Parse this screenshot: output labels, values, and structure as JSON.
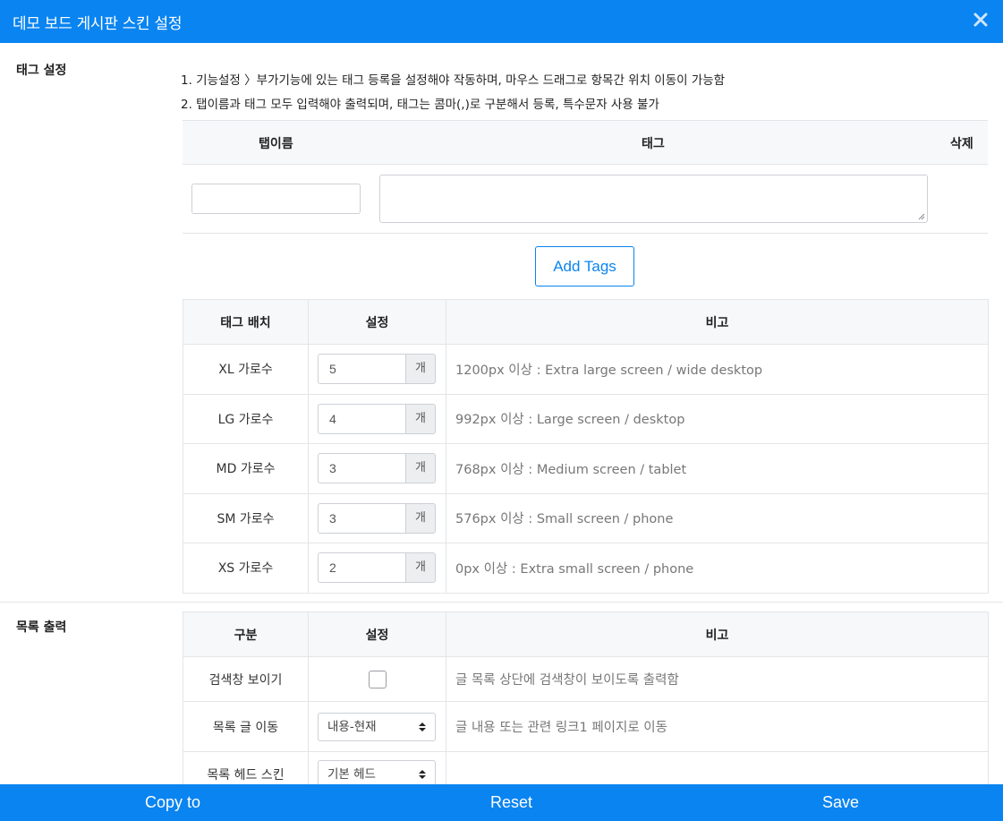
{
  "dialog": {
    "title": "데모 보드 게시판 스킨 설정",
    "close_icon": "close-icon"
  },
  "tag_settings": {
    "label": "태그 설정",
    "notes": [
      "1. 기능설정 〉부가기능에 있는 태그 등록을 설정해야 작동하며, 마우스 드래그로 항목간 위치 이동이 가능함",
      "2. 탭이름과 태그 모두 입력해야 출력되며, 태그는 콤마(,)로 구분해서 등록, 특수문자 사용 불가"
    ],
    "headers": {
      "tab_name": "탭이름",
      "tags": "태그",
      "delete": "삭제"
    },
    "tab_name_value": "",
    "tags_value": "",
    "add_button": "Add Tags"
  },
  "tag_layout": {
    "headers": [
      "태그 배치",
      "설정",
      "비고"
    ],
    "unit": "개",
    "rows": [
      {
        "name": "XL 가로수",
        "value": "5",
        "note": "1200px 이상 : Extra large screen / wide desktop"
      },
      {
        "name": "LG 가로수",
        "value": "4",
        "note": "992px 이상 : Large screen / desktop"
      },
      {
        "name": "MD 가로수",
        "value": "3",
        "note": "768px 이상 : Medium screen / tablet"
      },
      {
        "name": "SM 가로수",
        "value": "3",
        "note": "576px 이상 : Small screen / phone"
      },
      {
        "name": "XS 가로수",
        "value": "2",
        "note": "0px 이상 : Extra small screen / phone"
      }
    ]
  },
  "list_output": {
    "label": "목록 출력",
    "headers": [
      "구분",
      "설정",
      "비고"
    ],
    "rows": [
      {
        "name": "검색창 보이기",
        "type": "checkbox",
        "checked": false,
        "note": "글 목록 상단에 검색창이 보이도록 출력함"
      },
      {
        "name": "목록 글 이동",
        "type": "select",
        "value": "내용-현재",
        "note": "글 내용 또는 관련 링크1 페이지로 이동"
      },
      {
        "name": "목록 헤드 스킨",
        "type": "select",
        "value": "기본 헤드",
        "note": ""
      }
    ]
  },
  "footer": {
    "copy": "Copy to",
    "reset": "Reset",
    "save": "Save"
  },
  "colors": {
    "accent": "#0a84f0",
    "header_bg": "#f7f8fa",
    "border": "#e3e5e8"
  }
}
